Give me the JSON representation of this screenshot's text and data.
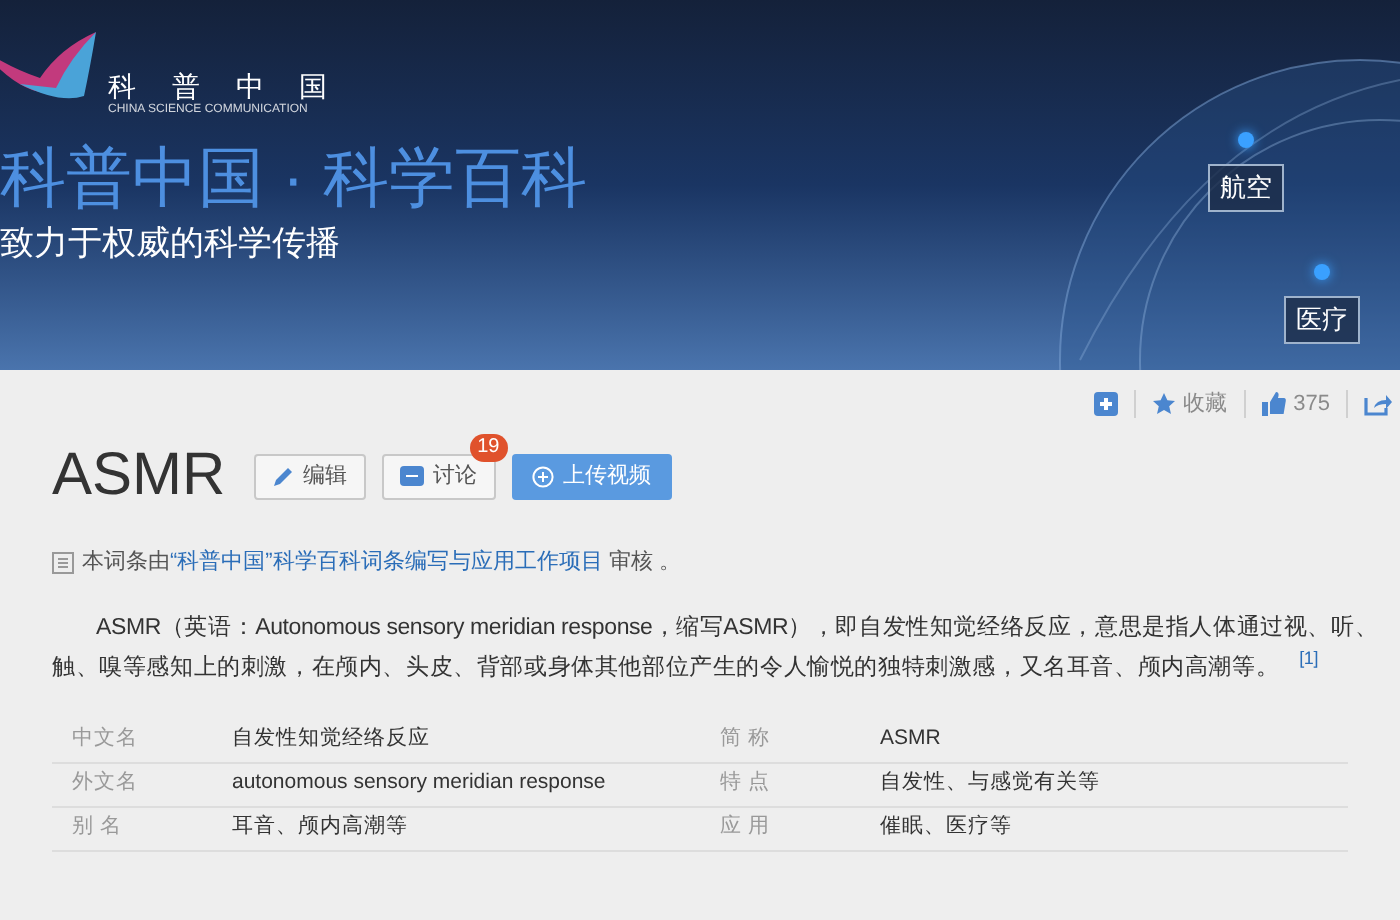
{
  "banner": {
    "logo_name": "科 普 中 国",
    "logo_subtitle": "CHINA SCIENCE COMMUNICATION",
    "title": "科普中国 · 科学百科",
    "subtitle": "致力于权威的科学传播",
    "tags": [
      {
        "label": "航空"
      },
      {
        "label": "医疗"
      }
    ]
  },
  "toolbar": {
    "favorite_label": "收藏",
    "like_count": "375"
  },
  "entry": {
    "title": "ASMR",
    "buttons": [
      {
        "kind": "edit",
        "label": "编辑"
      },
      {
        "kind": "discuss",
        "label": "讨论",
        "badge": "19"
      },
      {
        "kind": "upload",
        "label": "上传视频"
      }
    ]
  },
  "review_note": {
    "prefix": "本词条由",
    "link": "“科普中国”科学百科词条编写与应用工作项目",
    "suffix": " 审核 。"
  },
  "summary": {
    "text": "ASMR（英语：Autonomous sensory meridian response，缩写ASMR），即自发性知觉经络反应，意思是指人体通过视、听、触、嗅等感知上的刺激，在颅内、头皮、背部或身体其他部位产生的令人愉悦的独特刺激感，又名耳音、颅内高潮等。",
    "footnote": "[1]"
  },
  "infobox": {
    "left": [
      {
        "label": "中文名",
        "value": "自发性知觉经络反应"
      },
      {
        "label": "外文名",
        "value": "autonomous sensory meridian response"
      },
      {
        "label": "别 名",
        "value": "耳音、颅内高潮等"
      }
    ],
    "right": [
      {
        "label": "简 称",
        "value": "ASMR"
      },
      {
        "label": "特 点",
        "value": "自发性、与感觉有关等"
      },
      {
        "label": "应 用",
        "value": "催眠、医疗等"
      }
    ]
  }
}
